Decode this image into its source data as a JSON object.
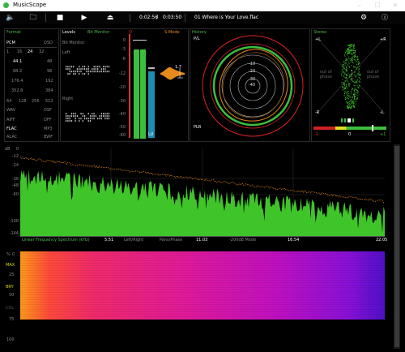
{
  "window": {
    "title": "MusicScope"
  },
  "toolbar": {
    "time_elapsed": "0:02:56",
    "time_separator": "/",
    "time_total": "0:03:50",
    "track": "01 Where is Your Love.flac"
  },
  "format": {
    "title": "Format",
    "pcm": "PCM",
    "dsd": "DSD",
    "bits": [
      "1",
      "16",
      "24",
      "32"
    ],
    "rates_left": [
      "44.1",
      "88.2",
      "176.4",
      "352.8"
    ],
    "rates_right": [
      "48",
      "96",
      "192",
      "384"
    ],
    "dsd_rates": [
      "64",
      "128",
      "256",
      "512"
    ],
    "codecs_left": [
      "WAV",
      "AIFF",
      "FLAC",
      "ALAC"
    ],
    "codecs_right": [
      "DSF",
      "DFF",
      "MP3",
      "BWF"
    ]
  },
  "levels": {
    "title": "Levels",
    "bit_monitor": "Bit Monitor",
    "bit_monitor_sub": "Bit Monitor",
    "left": "Left",
    "right": "Right",
    "scale": [
      "0",
      "-3",
      "-6",
      "-12",
      "-20",
      "-30",
      "-40",
      "-50",
      "-60"
    ],
    "lu": "LU",
    "dr_value": "1.7",
    "s_mode": "S-Mode",
    "q": "Q"
  },
  "history": {
    "title": "History",
    "pl": "P/L",
    "plr": "PLR",
    "rings": [
      "-10",
      "-20",
      "-30",
      "-40"
    ]
  },
  "stereo": {
    "title": "Stereo",
    "l_plus": "+L",
    "r_plus": "+R",
    "l_minus": "-L",
    "r_minus": "-R",
    "out_of_phase_l": "out of phase",
    "out_of_phase_r": "out of phase",
    "corr_min": "-1",
    "corr_mid": "0",
    "corr_max": "+1"
  },
  "spectrum": {
    "db_label": "dB",
    "y_ticks": [
      "0",
      "-12",
      "-24",
      "-36",
      "-48",
      "-60",
      "-100",
      "-144"
    ],
    "x_ticks": [
      "5.51",
      "11.03",
      "16.54",
      "22.05"
    ],
    "mode_linear": "Linear Frequency Spectrum (kHz)",
    "mode_leftright": "Left/Right",
    "mode_pans": "Pans/Phase",
    "mode_200": "-200dB Mode"
  },
  "spectrogram": {
    "y_ticks": [
      "%",
      "0",
      "25",
      "50",
      "75",
      "100"
    ],
    "labels": [
      "MAX",
      "BRY",
      "COL"
    ]
  },
  "colors": {
    "green": "#3fc42a",
    "orange": "#e68a1a",
    "accent": "#4fb94f"
  }
}
